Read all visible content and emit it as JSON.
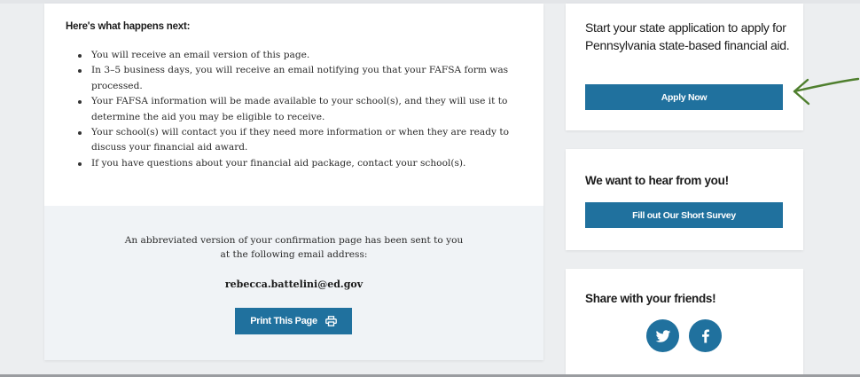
{
  "next_steps": {
    "title": "Here's what happens next:",
    "items": [
      "You will receive an email version of this page.",
      "In 3–5 business days, you will receive an email notifying you that your FAFSA form was processed.",
      "Your FAFSA information will be made available to your school(s), and they will use it to determine the aid you may be eligible to receive.",
      "Your school(s) will contact you if they need more information or when they are ready to discuss your financial aid award.",
      "If you have questions about your financial aid package, contact your school(s)."
    ]
  },
  "confirmation": {
    "line1": "An abbreviated version of your confirmation page has been sent to you",
    "line2": "at the following email address:",
    "email": "rebecca.battelini@ed.gov",
    "print_label": "Print This Page"
  },
  "state_app": {
    "heading": "Start your state application to apply for Pennsylvania state-based financial aid.",
    "button_label": "Apply Now"
  },
  "survey": {
    "heading": "We want to hear from you!",
    "button_label": "Fill out Our Short Survey"
  },
  "share": {
    "heading": "Share with your friends!",
    "icons": [
      "twitter-icon",
      "facebook-icon"
    ]
  },
  "colors": {
    "button": "#20719e",
    "background": "#eceef0",
    "panel": "#f0f3f6",
    "arrow": "#4f7f2e"
  }
}
